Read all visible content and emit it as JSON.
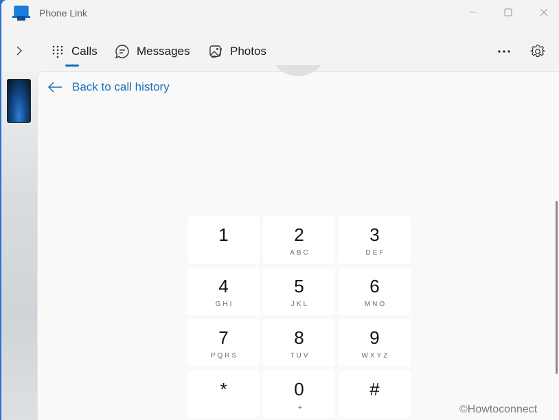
{
  "window": {
    "title": "Phone Link",
    "controls": {
      "minimize": "minimize",
      "maximize": "maximize",
      "close": "close"
    }
  },
  "nav": {
    "expand_icon": "chevron-right-icon",
    "tabs": [
      {
        "label": "Calls",
        "icon": "dialpad-icon",
        "selected": true
      },
      {
        "label": "Messages",
        "icon": "chat-bubble-icon",
        "selected": false
      },
      {
        "label": "Photos",
        "icon": "image-icon",
        "selected": false
      }
    ],
    "more_icon": "more-horizontal-icon",
    "settings_icon": "gear-icon"
  },
  "content": {
    "back_link": "Back to call history",
    "keypad": [
      {
        "digit": "1",
        "letters": ""
      },
      {
        "digit": "2",
        "letters": "ABC"
      },
      {
        "digit": "3",
        "letters": "DEF"
      },
      {
        "digit": "4",
        "letters": "GHI"
      },
      {
        "digit": "5",
        "letters": "JKL"
      },
      {
        "digit": "6",
        "letters": "MNO"
      },
      {
        "digit": "7",
        "letters": "PQRS"
      },
      {
        "digit": "8",
        "letters": "TUV"
      },
      {
        "digit": "9",
        "letters": "WXYZ"
      },
      {
        "digit": "*",
        "letters": ""
      },
      {
        "digit": "0",
        "letters": "+"
      },
      {
        "digit": "#",
        "letters": ""
      }
    ]
  },
  "watermark": "©Howtoconnect",
  "colors": {
    "accent": "#0f6cbd",
    "link": "#1a6fb8"
  }
}
